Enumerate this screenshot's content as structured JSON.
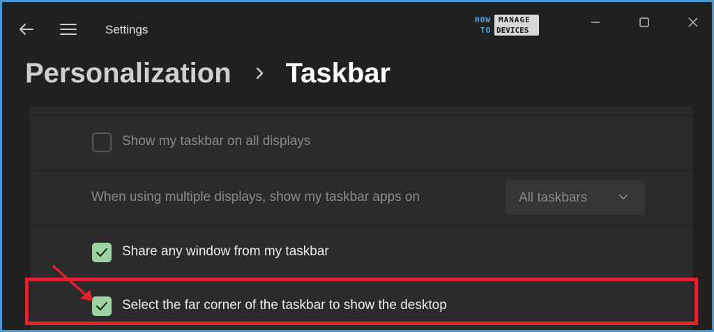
{
  "app": {
    "title": "Settings"
  },
  "logo": {
    "line1": "HOW",
    "line2": "TO",
    "line3": "MANAGE",
    "line4": "DEVICES"
  },
  "breadcrumb": {
    "parent": "Personalization",
    "current": "Taskbar"
  },
  "settings": {
    "show_all_displays": {
      "label": "Show my taskbar on all displays",
      "checked": false
    },
    "multi_display_apps": {
      "label": "When using multiple displays, show my taskbar apps on",
      "value": "All taskbars"
    },
    "share_window": {
      "label": "Share any window from my taskbar",
      "checked": true
    },
    "far_corner": {
      "label": "Select the far corner of the taskbar to show the desktop",
      "checked": true
    }
  },
  "colors": {
    "accent_check": "#9cd3a2",
    "highlight": "#e0232f",
    "background": "#202020",
    "card": "#2b2b2b"
  }
}
